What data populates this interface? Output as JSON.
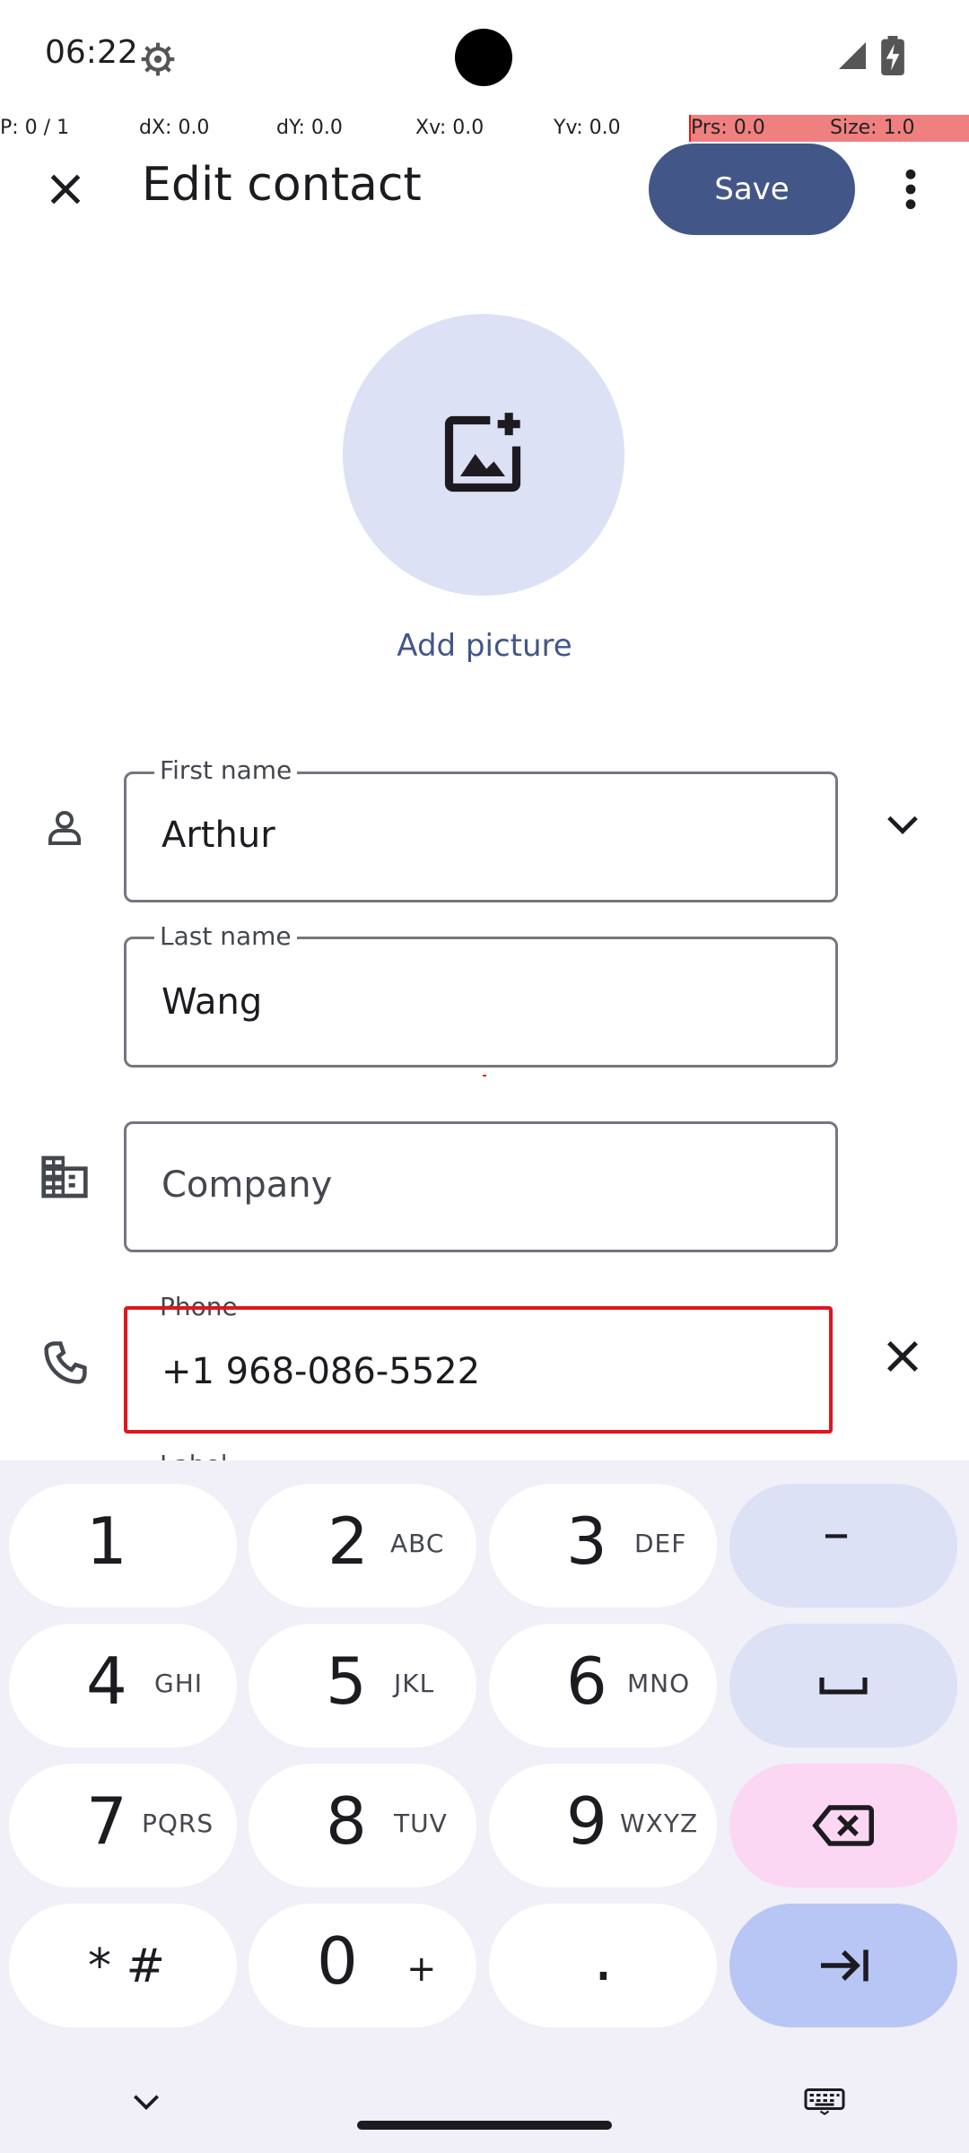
{
  "status_bar": {
    "time": "06:22"
  },
  "debug": [
    "P: 0 / 1",
    "dX: 0.0",
    "dY: 0.0",
    "Xv: 0.0",
    "Yv: 0.0",
    "Prs: 0.0",
    "Size: 1.0"
  ],
  "app_bar": {
    "title": "Edit contact",
    "save_label": "Save"
  },
  "avatar": {
    "add_picture_label": "Add picture"
  },
  "fields": {
    "first_name": {
      "label": "First name",
      "value": "Arthur"
    },
    "last_name": {
      "label": "Last name",
      "value": "Wang"
    },
    "company": {
      "placeholder": "Company"
    },
    "phone": {
      "label": "Phone",
      "value": "+1 968-086-5522"
    },
    "partial_label": "Label"
  },
  "keyboard": {
    "keys": [
      {
        "num": "1",
        "letters": ""
      },
      {
        "num": "2",
        "letters": "ABC"
      },
      {
        "num": "3",
        "letters": "DEF"
      },
      {
        "num": "4",
        "letters": "GHI"
      },
      {
        "num": "5",
        "letters": "JKL"
      },
      {
        "num": "6",
        "letters": "MNO"
      },
      {
        "num": "7",
        "letters": "PQRS"
      },
      {
        "num": "8",
        "letters": "TUV"
      },
      {
        "num": "9",
        "letters": "WXYZ"
      },
      {
        "num": "* #",
        "letters": ""
      },
      {
        "num": "0",
        "letters": "+"
      },
      {
        "num": ".",
        "letters": ""
      }
    ],
    "dash": "–"
  },
  "colors": {
    "accent": "#435688",
    "highlight_border": "#e0161c"
  }
}
